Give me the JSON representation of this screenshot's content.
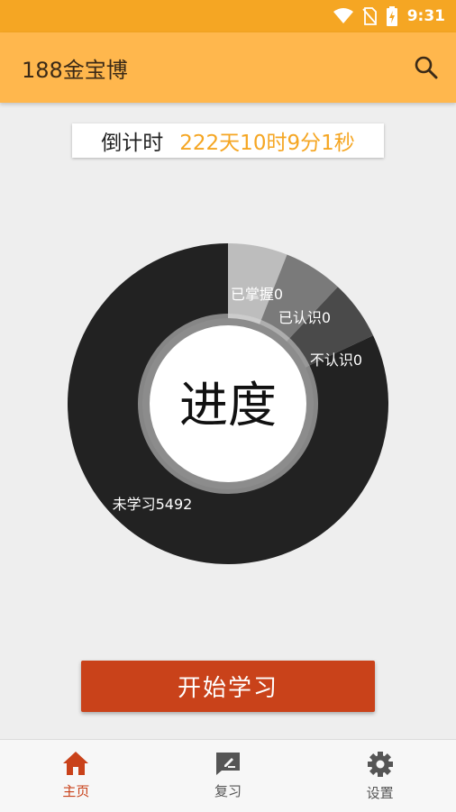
{
  "status_bar": {
    "time": "9:31",
    "icons": [
      "wifi-icon",
      "no-sim-icon",
      "battery-charging-icon"
    ]
  },
  "app_bar": {
    "title": "188金宝博",
    "search_icon": "search-icon"
  },
  "countdown": {
    "label": "倒计时",
    "value": "222天10时9分1秒",
    "value_color": "#f5a623"
  },
  "chart_data": {
    "type": "pie",
    "center_label": "进度",
    "slices": [
      {
        "label": "已掌握0",
        "value": 0.6,
        "color": "#bdbdbd"
      },
      {
        "label": "已认识0",
        "value": 0.6,
        "color": "#7a7a7a"
      },
      {
        "label": "不认识0",
        "value": 0.6,
        "color": "#4a4a4a"
      },
      {
        "label": "未学习5492",
        "value": 8.2,
        "color": "#222222"
      }
    ]
  },
  "start_button": {
    "label": "开始学习",
    "color": "#c9421a"
  },
  "bottom_nav": {
    "items": [
      {
        "label": "主页",
        "icon": "home-icon",
        "active": true
      },
      {
        "label": "复习",
        "icon": "review-icon",
        "active": false
      },
      {
        "label": "设置",
        "icon": "gear-icon",
        "active": false
      }
    ]
  }
}
